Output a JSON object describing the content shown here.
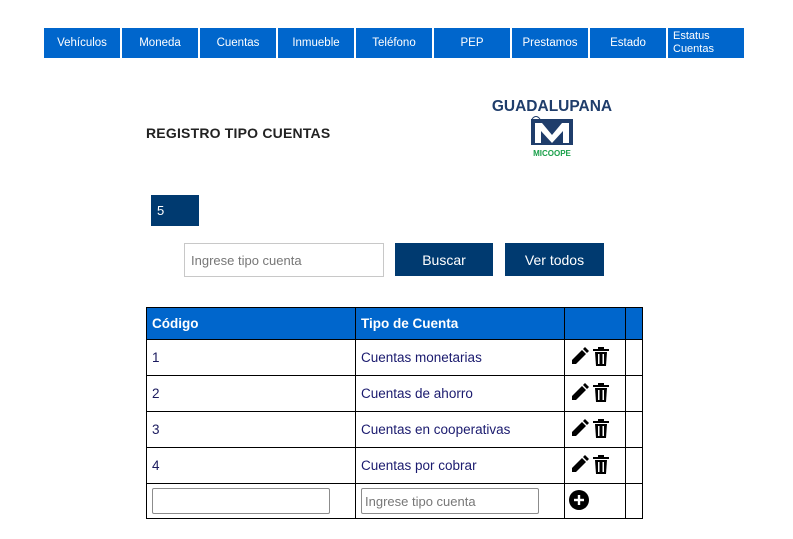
{
  "nav": {
    "items": [
      "Vehículos",
      "Moneda",
      "Cuentas",
      "Inmueble",
      "Teléfono",
      "PEP",
      "Prestamos",
      "Estado",
      "Estatus\nCuentas"
    ]
  },
  "page": {
    "title": "REGISTRO TIPO CUENTAS",
    "record_count": "5"
  },
  "logo": {
    "line1": "GUADALUPANA",
    "line2": "MICOOPE",
    "brand_blue": "#1f3d6b",
    "brand_green": "#1aa04a"
  },
  "search": {
    "placeholder": "Ingrese tipo cuenta",
    "search_label": "Buscar",
    "view_all_label": "Ver todos"
  },
  "table": {
    "headers": [
      "Código",
      "Tipo de Cuenta",
      "",
      ""
    ],
    "rows": [
      {
        "code": "1",
        "type": "Cuentas monetarias"
      },
      {
        "code": "2",
        "type": "Cuentas de ahorro"
      },
      {
        "code": "3",
        "type": "Cuentas en cooperativas"
      },
      {
        "code": "4",
        "type": "Cuentas por cobrar"
      }
    ],
    "new_row": {
      "code_value": "",
      "type_placeholder": "Ingrese tipo cuenta"
    }
  },
  "icons": {
    "edit": "pencil-icon",
    "delete": "trash-icon",
    "add": "plus-circle-icon"
  },
  "colors": {
    "nav_bg": "#0066cc",
    "button_bg": "#003a70",
    "header_bg": "#0066cc"
  }
}
